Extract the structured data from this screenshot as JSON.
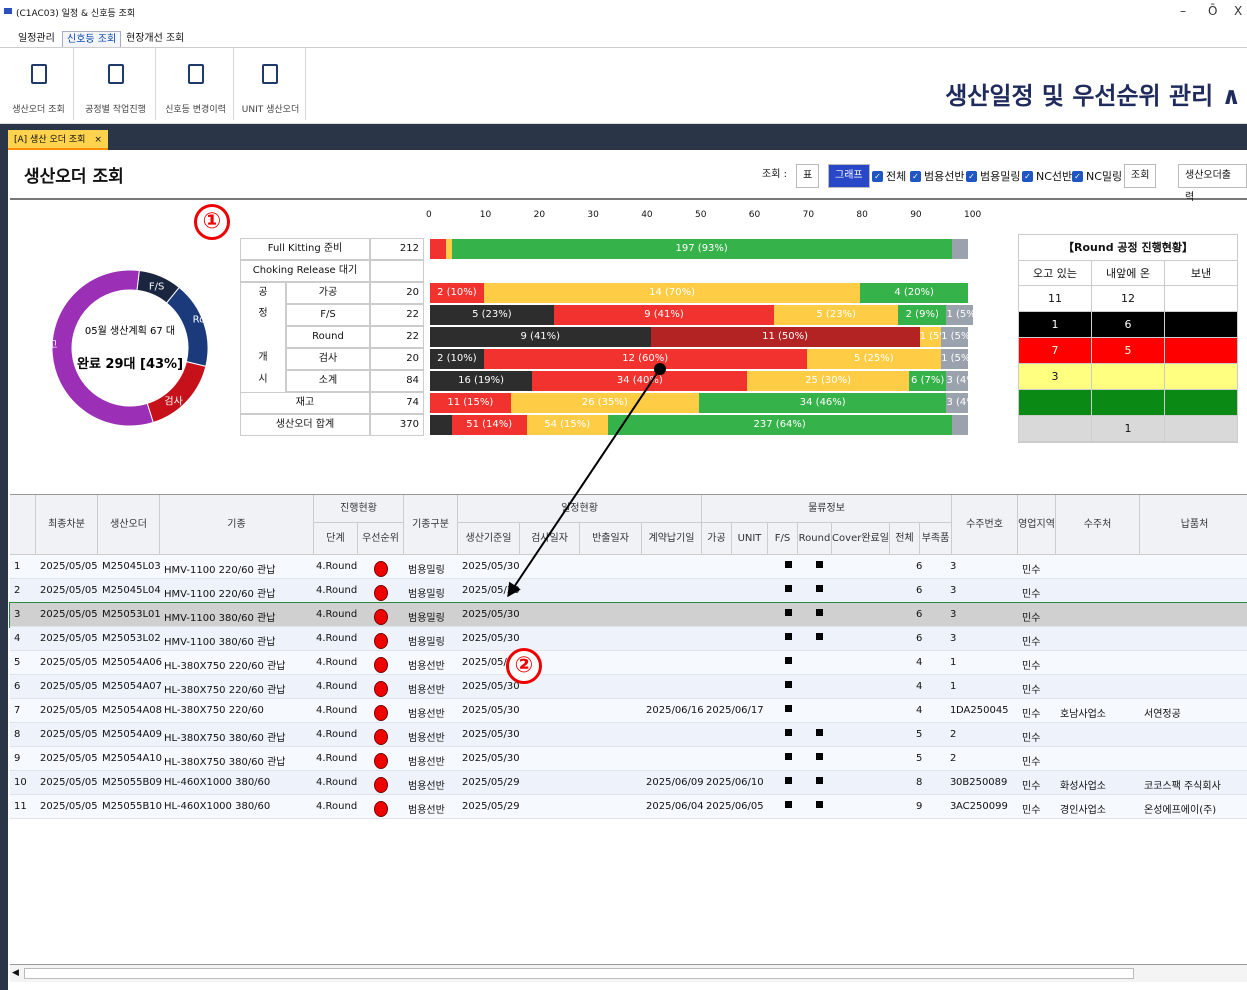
{
  "window": {
    "title": "(C1AC03) 일정 & 신호등 조회",
    "minimize": "–",
    "restore": "Ō",
    "close": "X"
  },
  "menu": {
    "tabs": [
      "일정관리",
      "신호등 조회",
      "현장개선 조회"
    ],
    "active": 1
  },
  "ribbon": {
    "buttons": [
      "생산오더 조회",
      "공정별 작업진행",
      "신호등 변경이력",
      "UNIT 생산오더"
    ],
    "app_title": "생산일정 및 우선순위 관리 ∧"
  },
  "doc_tab": {
    "label": "[A] 생산 오더 조회",
    "close": "×"
  },
  "page": {
    "title": "생산오더 조회",
    "view_label": "조회 :",
    "view_table": "표",
    "view_graph": "그래프",
    "filters": [
      "전체",
      "범용선반",
      "범용밀링",
      "NC선반",
      "NC밀링"
    ],
    "search_button": "조회",
    "print_button": "생산오더출력"
  },
  "annotations": {
    "one": "①",
    "two": "②"
  },
  "donut": {
    "center_top": "05월 생산계획 67 대",
    "center_main": "완료 29대 [43%]",
    "slices": [
      {
        "label": "F/S",
        "value": 6,
        "color": "#1a2540"
      },
      {
        "label": "Round",
        "value": 12,
        "color": "#1a3a7c"
      },
      {
        "label": "검사",
        "value": 11,
        "color": "#c6111b"
      },
      {
        "label": "재고",
        "value": 38,
        "color": "#9b2fb5"
      }
    ]
  },
  "bars": {
    "axis": [
      "0",
      "10",
      "20",
      "30",
      "40",
      "50",
      "60",
      "70",
      "80",
      "90",
      "100"
    ],
    "rows": [
      {
        "label": "Full Kitting 준비",
        "group": "",
        "count": "212",
        "segs": [
          [
            3,
            "r",
            ""
          ],
          [
            1,
            "y",
            ""
          ],
          [
            93,
            "g",
            "197 (93%)"
          ],
          [
            3,
            "gr",
            ""
          ]
        ]
      },
      {
        "label": "Choking Release 대기",
        "group": "",
        "count": "",
        "segs": []
      },
      {
        "label": "가공",
        "group": "공",
        "count": "20",
        "segs": [
          [
            10,
            "r",
            "2 (10%)"
          ],
          [
            70,
            "y",
            "14 (70%)"
          ],
          [
            20,
            "g",
            "4 (20%)"
          ]
        ]
      },
      {
        "label": "F/S",
        "group": "정",
        "count": "22",
        "segs": [
          [
            23,
            "k",
            "5 (23%)"
          ],
          [
            41,
            "r",
            "9 (41%)"
          ],
          [
            23,
            "y",
            "5 (23%)"
          ],
          [
            9,
            "g",
            "2 (9%)"
          ],
          [
            5,
            "gr",
            "1 (5%)"
          ]
        ]
      },
      {
        "label": "Round",
        "group": "",
        "count": "22",
        "segs": [
          [
            41,
            "k",
            "9 (41%)"
          ],
          [
            50,
            "dr",
            "11 (50%)"
          ],
          [
            4,
            "y",
            "1 (5%)"
          ],
          [
            5,
            "gr",
            "1 (5%)"
          ]
        ]
      },
      {
        "label": "검사",
        "group": "개",
        "count": "20",
        "segs": [
          [
            10,
            "k",
            "2 (10%)"
          ],
          [
            60,
            "r",
            "12 (60%)"
          ],
          [
            25,
            "y",
            "5 (25%)"
          ],
          [
            5,
            "gr",
            "1 (5%)"
          ]
        ]
      },
      {
        "label": "소계",
        "group": "시",
        "count": "84",
        "segs": [
          [
            19,
            "k",
            "16 (19%)"
          ],
          [
            40,
            "r",
            "34 (40%)"
          ],
          [
            30,
            "y",
            "25 (30%)"
          ],
          [
            7,
            "g",
            "6 (7%)"
          ],
          [
            4,
            "gr",
            "3 (4%)"
          ]
        ]
      },
      {
        "label": "재고",
        "group": "",
        "count": "74",
        "segs": [
          [
            15,
            "r",
            "11 (15%)"
          ],
          [
            35,
            "y",
            "26 (35%)"
          ],
          [
            46,
            "g",
            "34 (46%)"
          ],
          [
            4,
            "gr",
            "3 (4%)"
          ]
        ]
      },
      {
        "label": "생산오더 합계",
        "group": "",
        "count": "370",
        "segs": [
          [
            4,
            "k",
            ""
          ],
          [
            14,
            "r",
            "51 (14%)"
          ],
          [
            15,
            "y",
            "54 (15%)"
          ],
          [
            64,
            "g",
            "237 (64%)"
          ],
          [
            3,
            "gr",
            ""
          ]
        ]
      }
    ]
  },
  "round_table": {
    "title": "【Round 공정 진행현황】",
    "headers": [
      "오고 있는",
      "내앞에 온",
      "보낸"
    ],
    "rows": [
      {
        "cells": [
          "11",
          "12",
          ""
        ],
        "bg": "#ffffff",
        "fg": "#111"
      },
      {
        "cells": [
          "1",
          "6",
          ""
        ],
        "bg": "#000000",
        "fg": "#fff"
      },
      {
        "cells": [
          "7",
          "5",
          ""
        ],
        "bg": "#ff0000",
        "fg": "#ffe"
      },
      {
        "cells": [
          "3",
          "",
          ""
        ],
        "bg": "#ffff80",
        "fg": "#111"
      },
      {
        "cells": [
          "",
          "",
          ""
        ],
        "bg": "#0a8a14",
        "fg": "#fff"
      },
      {
        "cells": [
          "",
          "1",
          ""
        ],
        "bg": "#d9d9d9",
        "fg": "#111"
      }
    ]
  },
  "grid": {
    "group_headers": [
      "진행현황",
      "일정현황",
      "물류정보"
    ],
    "headers": [
      "최종차분",
      "생산오더",
      "기종",
      "단계",
      "우선순위",
      "기종구분",
      "생산기준일",
      "검사일자",
      "반출일자",
      "계약납기일",
      "가공",
      "UNIT",
      "F/S",
      "Round",
      "Cover완료일",
      "전체",
      "부족품",
      "수주번호",
      "영업지역",
      "수주처",
      "납품처"
    ],
    "rows": [
      [
        "1",
        "2025/05/05",
        "M25045L03",
        "HMV-1100 220/60 관납",
        "4.Round",
        "범용밀링",
        "2025/05/30",
        "",
        "",
        "",
        "1",
        "1",
        "6",
        "3",
        "",
        "민수",
        "",
        ""
      ],
      [
        "2",
        "2025/05/05",
        "M25045L04",
        "HMV-1100 220/60 관납",
        "4.Round",
        "범용밀링",
        "2025/05/30",
        "",
        "",
        "",
        "1",
        "1",
        "6",
        "3",
        "",
        "민수",
        "",
        ""
      ],
      [
        "3",
        "2025/05/05",
        "M25053L01",
        "HMV-1100 380/60 관납",
        "4.Round",
        "범용밀링",
        "2025/05/30",
        "",
        "",
        "",
        "1",
        "1",
        "6",
        "3",
        "",
        "민수",
        "",
        ""
      ],
      [
        "4",
        "2025/05/05",
        "M25053L02",
        "HMV-1100 380/60 관납",
        "4.Round",
        "범용밀링",
        "2025/05/30",
        "",
        "",
        "",
        "1",
        "1",
        "6",
        "3",
        "",
        "민수",
        "",
        ""
      ],
      [
        "5",
        "2025/05/05",
        "M25054A06",
        "HL-380X750 220/60 관납",
        "4.Round",
        "범용선반",
        "2025/05/30",
        "",
        "",
        "",
        "1",
        "0",
        "4",
        "1",
        "",
        "민수",
        "",
        ""
      ],
      [
        "6",
        "2025/05/05",
        "M25054A07",
        "HL-380X750 220/60 관납",
        "4.Round",
        "범용선반",
        "2025/05/30",
        "",
        "",
        "",
        "1",
        "0",
        "4",
        "1",
        "",
        "민수",
        "",
        ""
      ],
      [
        "7",
        "2025/05/05",
        "M25054A08",
        "HL-380X750 220/60",
        "4.Round",
        "범용선반",
        "2025/05/30",
        "",
        "2025/06/16",
        "2025/06/17",
        "1",
        "0",
        "4",
        "1",
        "DA250045",
        "민수",
        "호남사업소",
        "서연정공"
      ],
      [
        "8",
        "2025/05/05",
        "M25054A09",
        "HL-380X750 380/60 관납",
        "4.Round",
        "범용선반",
        "2025/05/30",
        "",
        "",
        "",
        "1",
        "1",
        "5",
        "2",
        "",
        "민수",
        "",
        ""
      ],
      [
        "9",
        "2025/05/05",
        "M25054A10",
        "HL-380X750 380/60 관납",
        "4.Round",
        "범용선반",
        "2025/05/30",
        "",
        "",
        "",
        "1",
        "1",
        "5",
        "2",
        "",
        "민수",
        "",
        ""
      ],
      [
        "10",
        "2025/05/05",
        "M25055B09",
        "HL-460X1000 380/60",
        "4.Round",
        "범용선반",
        "2025/05/29",
        "",
        "2025/06/09",
        "2025/06/10",
        "1",
        "1",
        "8",
        "3",
        "0B250089",
        "민수",
        "화성사업소",
        "코코스팩 주식회사"
      ],
      [
        "11",
        "2025/05/05",
        "M25055B10",
        "HL-460X1000 380/60",
        "4.Round",
        "범용선반",
        "2025/05/29",
        "",
        "2025/06/04",
        "2025/06/05",
        "1",
        "1",
        "9",
        "3",
        "AC250099",
        "민수",
        "경인사업소",
        "온성에프에이(주)"
      ]
    ],
    "selected_row": 2
  }
}
